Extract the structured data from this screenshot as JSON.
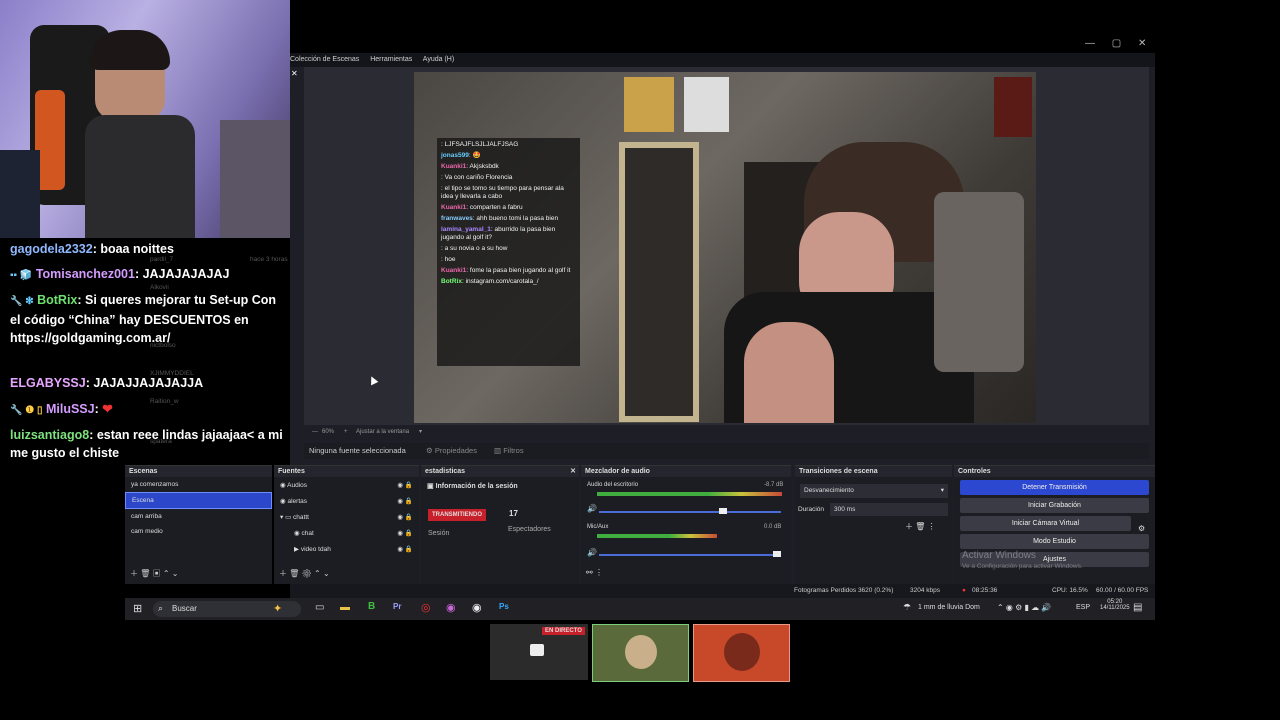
{
  "menubar": {
    "items": [
      "Colección de Escenas",
      "Herramientas",
      "Ayuda (H)"
    ]
  },
  "window_controls": {
    "minimize": "—",
    "maximize": "▢",
    "close": "✕"
  },
  "chat_overlay": {
    "messages": [
      {
        "user": "",
        "text": ": LJFSAJFLSJLJALFJSAG",
        "ucolor": "#e33"
      },
      {
        "user": "jonas599",
        "text": ": 🤩",
        "ucolor": "#6cf"
      },
      {
        "user": "Kuanki1",
        "text": ": Akjsksbdk",
        "ucolor": "#e6a"
      },
      {
        "user": "",
        "text": ": Va con cariño Florencia",
        "ucolor": "#e33"
      },
      {
        "user": "",
        "text": ": el tipo se tomo su tiempo para pensar ala idea y llevarla a cabo",
        "ucolor": "#e33"
      },
      {
        "user": "Kuanki1",
        "text": ": comparten a fabru",
        "ucolor": "#e6a"
      },
      {
        "user": "franwaves",
        "text": ": ahh bueno tomi la pasa bien",
        "ucolor": "#8cf"
      },
      {
        "user": "lamina_yamal_1",
        "text": ": aburrido la pasa bien jugando al golf it?",
        "ucolor": "#a8f"
      },
      {
        "user": "",
        "text": ": a su novia o a su how",
        "ucolor": "#e33"
      },
      {
        "user": "",
        "text": ": hoe",
        "ucolor": "#e33"
      },
      {
        "user": "Kuanki1",
        "text": ": fome la pasa bien jugando al golf it",
        "ucolor": "#e6a"
      },
      {
        "user": "BotRix",
        "text": ": instagram.com/carotala_/",
        "ucolor": "#7f7"
      }
    ]
  },
  "zoombar": {
    "zoom": "60%",
    "fit": "Ajustar a la ventana"
  },
  "source_bar": {
    "none_selected": "Ninguna fuente seleccionada",
    "properties": "Propiedades",
    "filters": "Filtros"
  },
  "scenes": {
    "title": "Escenas",
    "items": [
      "ya comenzamos",
      "Escena",
      "cam arriba",
      "cam medio"
    ]
  },
  "sources": {
    "title": "Fuentes",
    "items": [
      "Audios",
      "alertas",
      "chattt",
      "chat",
      "video tdah"
    ]
  },
  "stats": {
    "title": "estadisticas",
    "session_info": "Información de la sesión",
    "live_badge": "TRANSMITIENDO",
    "session_label": "Sesión",
    "viewers": "17",
    "viewers_label": "Espectadores"
  },
  "mixer": {
    "title": "Mezclador de audio",
    "channels": [
      {
        "name": "Audio del escritorio",
        "db": "-8.7 dB"
      },
      {
        "name": "Mic/Aux",
        "db": "0.0 dB"
      }
    ],
    "scale": [
      "-60",
      "-55",
      "-50",
      "-45",
      "-40",
      "-35",
      "-30",
      "-25",
      "-20",
      "-15",
      "-10",
      "-5",
      "0"
    ]
  },
  "transitions": {
    "title": "Transiciones de escena",
    "selected": "Desvanecimiento",
    "duration_label": "Duración",
    "duration_value": "300 ms"
  },
  "controls": {
    "title": "Controles",
    "buttons": [
      "Detener Transmisión",
      "Iniciar Grabación",
      "Iniciar Cámara Virtual",
      "Modo Estudio",
      "Ajustes"
    ],
    "activate_windows": "Activar Windows",
    "activate_sub": "Ve a Configuración para activar Windows."
  },
  "statusbar": {
    "dropped": "Fotogramas Perdidos 3620 (0.2%)",
    "bitrate": "3204 kbps",
    "time": "08:25:36",
    "cpu": "CPU: 16.5%",
    "fps": "60.00 / 60.00 FPS"
  },
  "taskbar": {
    "search": "Buscar",
    "weather": "1 mm de lluvia Dom",
    "lang": "ESP",
    "clock_time": "05:20",
    "clock_date": "14/11/2025"
  },
  "twitch_chat": {
    "messages": [
      {
        "user": "gagodela2332",
        "text": "boaa noittes",
        "ucolor": "#8fb8ff",
        "badges": ""
      },
      {
        "user": "Tomisanchez001",
        "text": "JAJAJAJAJAJ",
        "ucolor": "#d59cff",
        "badges": "▪▪ 🧊"
      },
      {
        "user": "BotRix",
        "text": "Si queres mejorar tu Set-up Con el código “China” hay DESCUENTOS en https://goldgaming.com.ar/",
        "ucolor": "#6fe06f",
        "badges": "🔧 ❇"
      },
      {
        "user": "ELGABYSSJ",
        "text": "JAJAJJAJAJAJJA",
        "ucolor": "#e7a6ff",
        "badges": ""
      },
      {
        "user": "MiluSSJ",
        "text": "❤",
        "ucolor": "#d59cff",
        "badges": "🔧 ❶ ▯"
      },
      {
        "user": "luizsantiago8",
        "text": "estan reee lindas jajaajaa< a mi me gusto el chiste",
        "ucolor": "#7ee07e",
        "badges": ""
      }
    ],
    "ghost_names": [
      "pardil_7",
      "Alkovii",
      "hace 3 horas",
      "nictbolso",
      "XJIMMYDDIEL",
      "Raition_w",
      "spatera"
    ]
  },
  "call": {
    "live_badge": "EN DIRECTO"
  },
  "colors": {
    "accent": "#2d48d0",
    "live_red": "#c8202a"
  }
}
